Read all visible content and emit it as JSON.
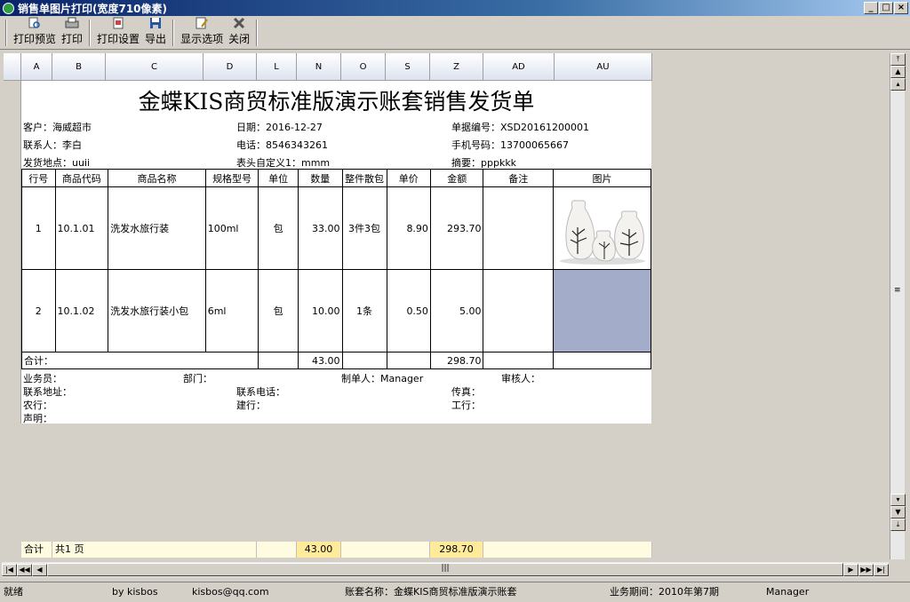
{
  "window": {
    "title": "销售单图片打印(宽度710像素)",
    "min": "_",
    "max": "□",
    "close": "×"
  },
  "toolbar": {
    "items": [
      {
        "label": "打印预览",
        "icon": "print-preview-icon"
      },
      {
        "label": "打印",
        "icon": "printer-icon"
      },
      {
        "label": "打印设置",
        "icon": "print-settings-icon"
      },
      {
        "label": "导出",
        "icon": "save-icon"
      },
      {
        "label": "显示选项",
        "icon": "display-options-icon"
      },
      {
        "label": "关闭",
        "icon": "close-x-icon"
      }
    ]
  },
  "columns": [
    "A",
    "B",
    "C",
    "D",
    "L",
    "N",
    "O",
    "S",
    "Z",
    "AD",
    "AU"
  ],
  "doc": {
    "title": "金蝶KIS商贸标准版演示账套销售发货单",
    "customer": "客户：海威超市",
    "date": "日期：2016-12-27",
    "docno": "单据编号：XSD20161200001",
    "contact": "联系人：李白",
    "phone": "电话：8546343261",
    "mobile": "手机号码：13700065667",
    "address": "发货地点：uuii",
    "custom1": "表头自定义1：mmm",
    "summary": "摘要：pppkkk",
    "headers": [
      "行号",
      "商品代码",
      "商品名称",
      "规格型号",
      "单位",
      "数量",
      "整件散包",
      "单价",
      "金额",
      "备注",
      "图片"
    ],
    "rows": [
      [
        "1",
        "10.1.01",
        "洗发水旅行装",
        "100ml",
        "包",
        "33.00",
        "3件3包",
        "8.90",
        "293.70",
        "",
        ""
      ],
      [
        "2",
        "10.1.02",
        "洗发水旅行装小包",
        "6ml",
        "包",
        "10.00",
        "1条",
        "0.50",
        "5.00",
        "",
        ""
      ]
    ],
    "total_label": "合计：",
    "total_qty": "43.00",
    "total_amount": "298.70",
    "salesman": "业务员：",
    "dept": "部门：",
    "maker": "制单人：Manager",
    "auditor": "审核人：",
    "contact_addr": "联系地址：",
    "contact_phone": "联系电话：",
    "fax": "传真：",
    "bank1": "农行：",
    "bank2": "建行：",
    "bank3": "工行：",
    "statement": "声明："
  },
  "summary_bar": {
    "label": "合计",
    "pages": "共1 页",
    "qty": "43.00",
    "amount": "298.70"
  },
  "status": {
    "ready": "就绪",
    "by": "by kisbos",
    "email": "kisbos@qq.com",
    "account": "账套名称：金蝶KIS商贸标准版演示账套",
    "period": "业务期间：2010年第7期",
    "user": "Manager"
  }
}
